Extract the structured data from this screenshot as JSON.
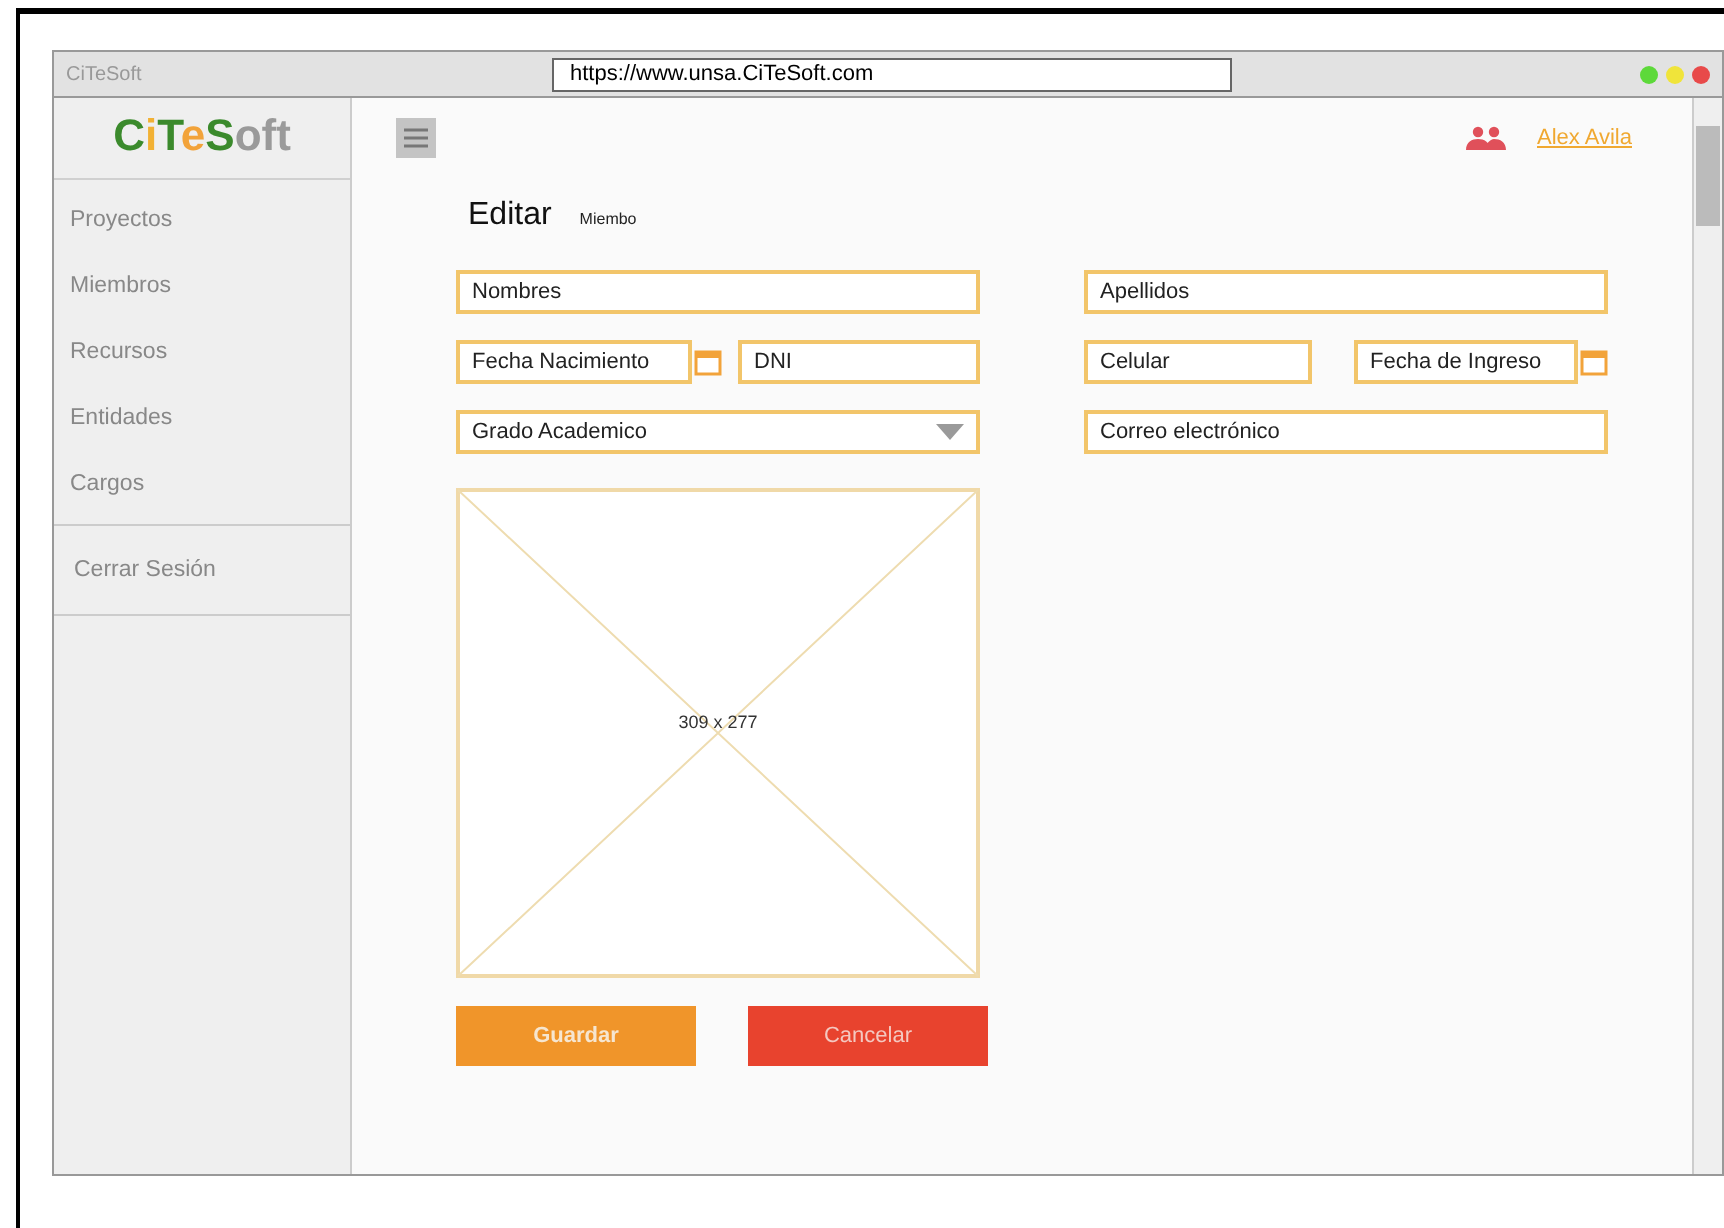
{
  "window": {
    "title": "CiTeSoft",
    "url": "https://www.unsa.CiTeSoft.com"
  },
  "logo": [
    {
      "text": "C",
      "color": "#3b8a2c"
    },
    {
      "text": "i",
      "color": "#f2b134"
    },
    {
      "text": "T",
      "color": "#3b8a2c"
    },
    {
      "text": "e",
      "color": "#f2a33a"
    },
    {
      "text": "S",
      "color": "#3b8a2c"
    },
    {
      "text": "oft",
      "color": "#9a9a9a"
    }
  ],
  "sidebar": {
    "items": [
      {
        "label": "Proyectos"
      },
      {
        "label": "Miembros"
      },
      {
        "label": "Recursos"
      },
      {
        "label": "Entidades"
      },
      {
        "label": "Cargos"
      }
    ],
    "logout": "Cerrar Sesión"
  },
  "user": {
    "name": "Alex Avila"
  },
  "page": {
    "title": "Editar",
    "subtitle": "Miembo"
  },
  "form": {
    "left": [
      {
        "kind": "text",
        "placeholder": "Nombres"
      },
      {
        "kind": "pair",
        "fields": [
          {
            "kind": "date",
            "placeholder": "Fecha Nacimiento"
          },
          {
            "kind": "text",
            "placeholder": "DNI"
          }
        ]
      },
      {
        "kind": "select",
        "placeholder": "Grado Academico"
      }
    ],
    "right": [
      {
        "kind": "text",
        "placeholder": "Apellidos"
      },
      {
        "kind": "pair",
        "fields": [
          {
            "kind": "text",
            "placeholder": "Celular"
          },
          {
            "kind": "date",
            "placeholder": "Fecha de Ingreso"
          }
        ]
      },
      {
        "kind": "text",
        "placeholder": "Correo electrónico"
      }
    ],
    "image": {
      "size": "309 x 277"
    }
  },
  "buttons": [
    {
      "kind": "primary",
      "label": "Guardar"
    },
    {
      "kind": "danger",
      "label": "Cancelar"
    }
  ]
}
